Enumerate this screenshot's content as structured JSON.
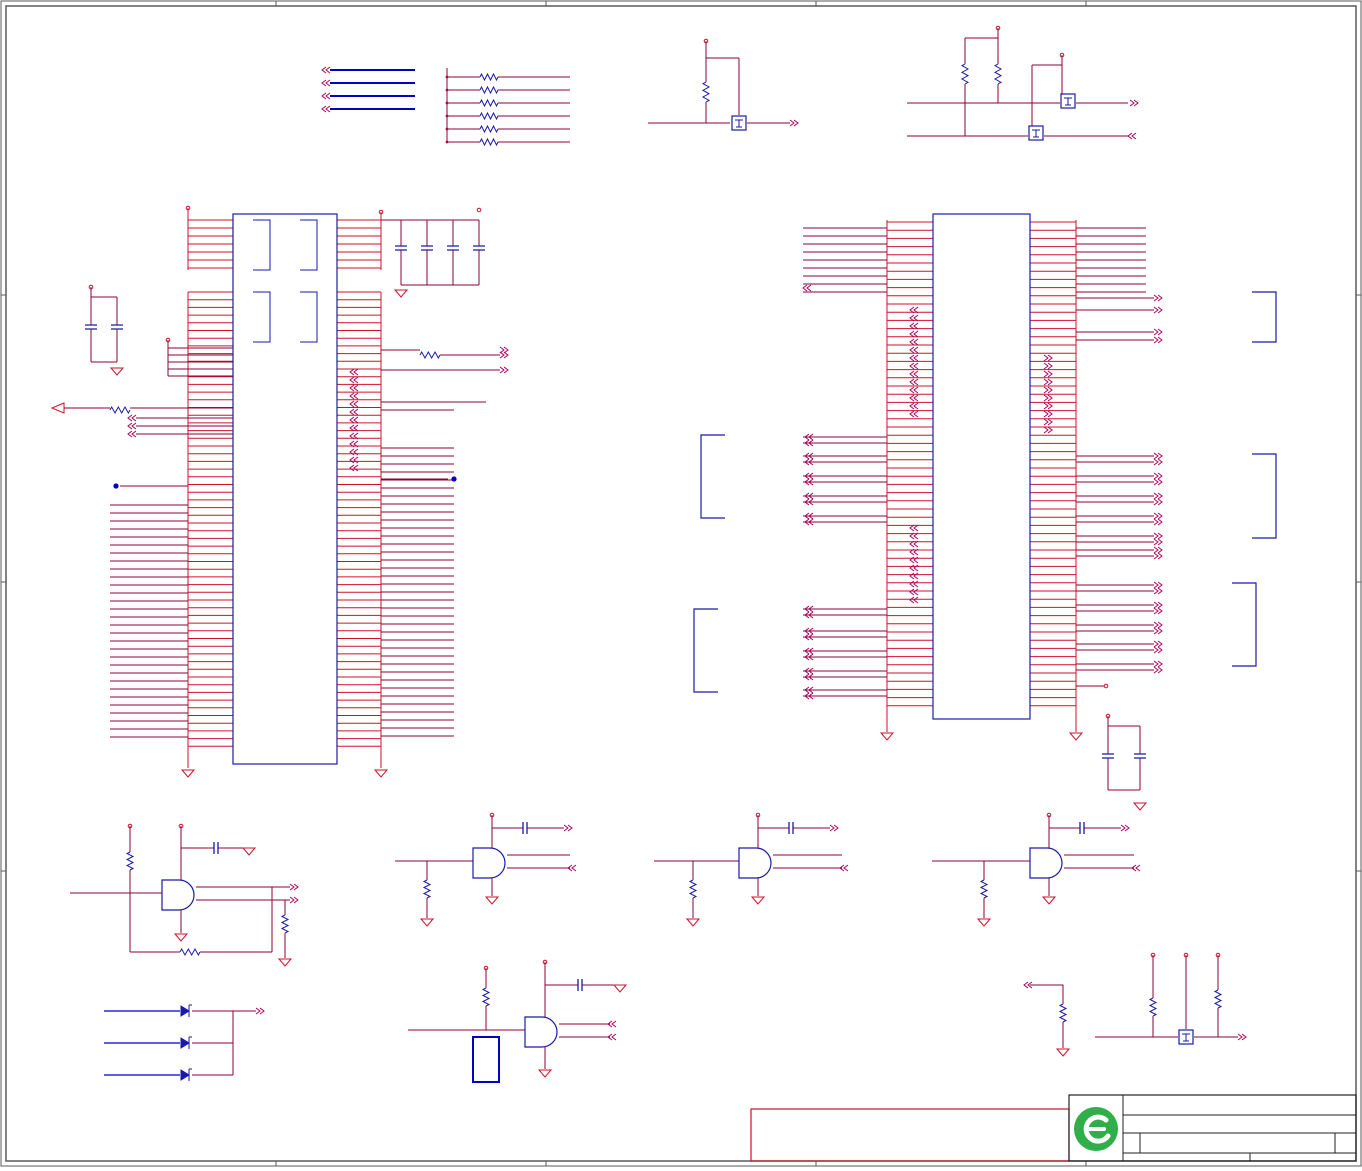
{
  "sheet": {
    "background": "#ffffff",
    "border_color": "#5a5a5a",
    "wire_color": "#8b0038",
    "net_color": "#b0005a",
    "power_color": "#d0102a",
    "part_color": "#1a1aa8",
    "bus_color": "#0000c0",
    "logo_color": "#2fae4a",
    "title_box_color": "#d0102a"
  },
  "title_block": {
    "logo": "green-circular-e-logo"
  }
}
